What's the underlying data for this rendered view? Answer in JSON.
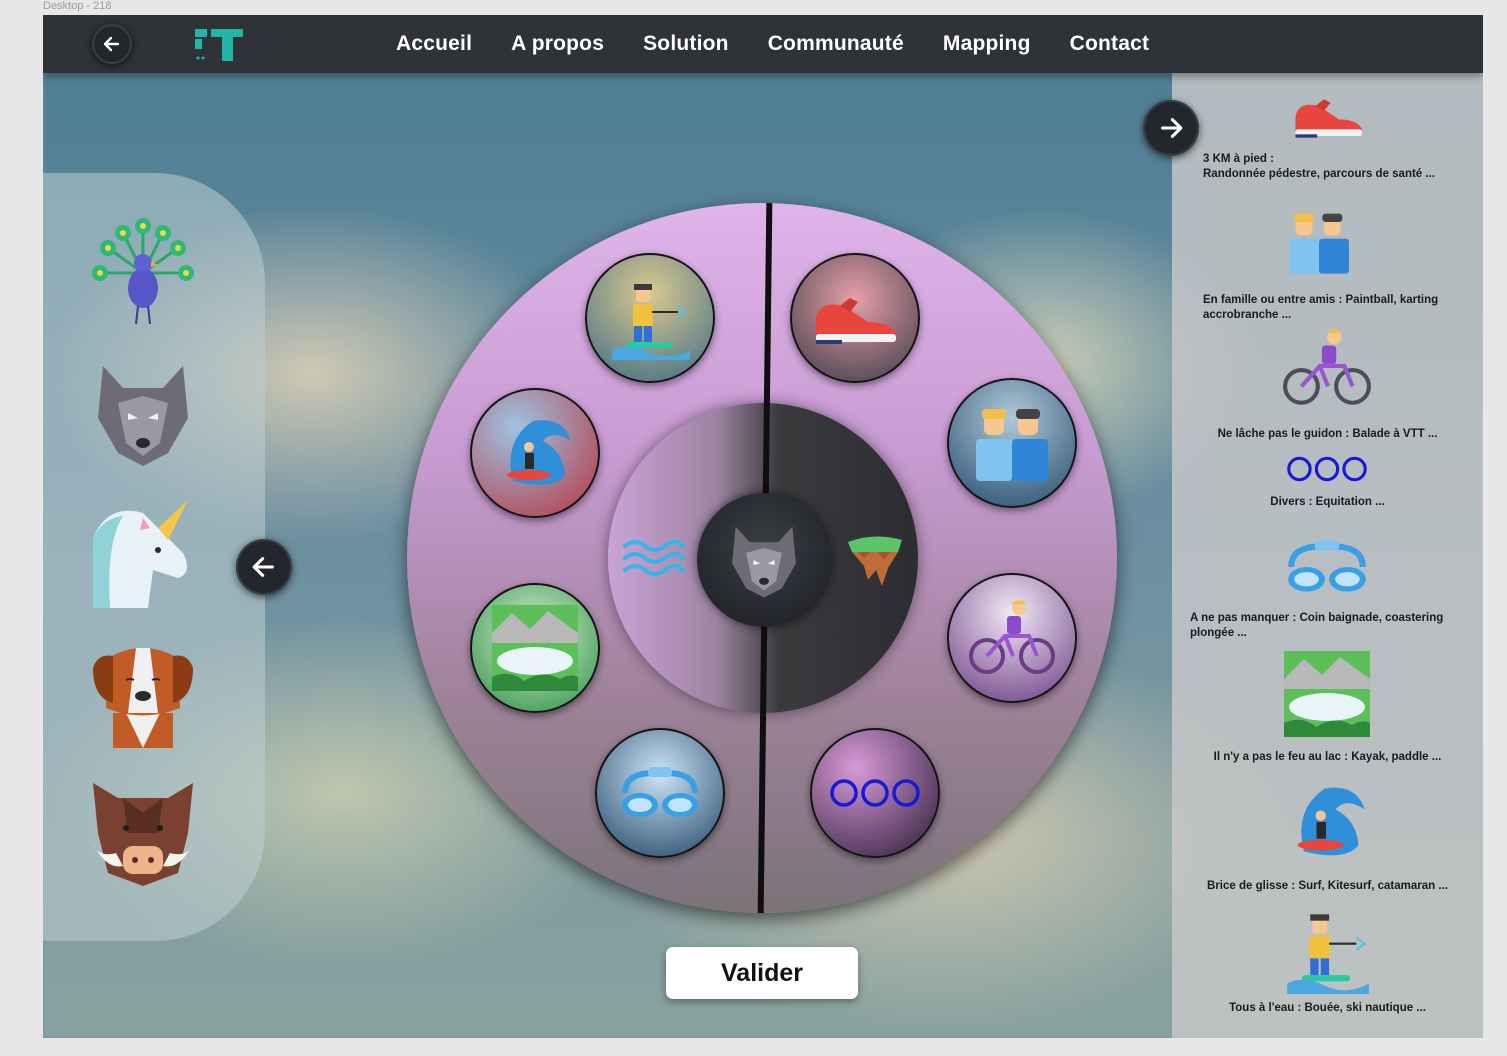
{
  "frame_label": "Desktop - 218",
  "nav": {
    "links": [
      "Accueil",
      "A propos",
      "Solution",
      "Communauté",
      "Mapping",
      "Contact"
    ]
  },
  "left_panel": {
    "animals": [
      "peacock-icon",
      "wolf-icon",
      "unicorn-icon",
      "dog-icon",
      "boar-icon"
    ]
  },
  "right_panel": {
    "items": [
      {
        "icon": "sneaker-icon",
        "line1": "3 KM à pied :",
        "line2": "Randonnée pédestre, parcours de santé ..."
      },
      {
        "icon": "friends-icon",
        "line1": "En famille ou entre amis : Paintball, karting",
        "line2": "accrobranche ..."
      },
      {
        "icon": "cyclist-icon",
        "line1": "Ne lâche pas le guidon : Balade à VTT ...",
        "line2": ""
      },
      {
        "icon": "more-circles-icon",
        "line1": "Divers : Equitation ...",
        "line2": ""
      },
      {
        "icon": "goggles-icon",
        "line1": "A ne pas manquer : Coin baignade, coastering",
        "line2": "plongée ..."
      },
      {
        "icon": "lake-icon",
        "line1": "Il n'y a pas le feu au lac : Kayak, paddle ...",
        "line2": ""
      },
      {
        "icon": "surf-icon",
        "line1": "Brice de glisse : Surf, Kitesurf, catamaran ...",
        "line2": ""
      },
      {
        "icon": "waterski-icon",
        "line1": "Tous à l'eau : Bouée, ski nautique ...",
        "line2": ""
      }
    ]
  },
  "wheel": {
    "center_icon": "wolf-icon",
    "left_category": "water-waves-icon",
    "right_category": "land-island-icon",
    "activities": [
      "waterski-icon",
      "surf-icon",
      "lake-icon",
      "goggles-icon",
      "sneaker-icon",
      "friends-icon",
      "cyclist-icon",
      "more-circles-icon"
    ]
  },
  "valider_label": "Valider",
  "colors": {
    "navbar": "#2f3337",
    "logo": "#1fb5a9",
    "wheel_top": "#dfb4ea",
    "accent_blue": "#1818d8"
  }
}
